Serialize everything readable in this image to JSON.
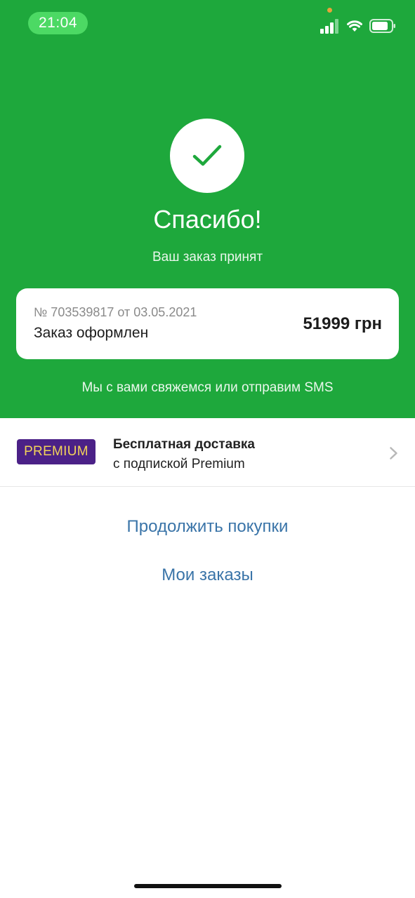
{
  "status_bar": {
    "time": "21:04",
    "icons": [
      "signal-icon",
      "wifi-icon",
      "battery-icon"
    ]
  },
  "confirmation": {
    "icon": "checkmark-icon",
    "title": "Спасибо!",
    "subtitle": "Ваш заказ принят"
  },
  "order": {
    "meta": "№ 703539817 от 03.05.2021",
    "status": "Заказ оформлен",
    "price": "51999 грн"
  },
  "note": "Мы с вами свяжемся или отправим SMS",
  "premium": {
    "badge": "PREMIUM",
    "title": "Бесплатная доставка",
    "subtitle": "с подпиской Premium"
  },
  "actions": {
    "continue_label": "Продолжить покупки",
    "orders_label": "Мои заказы"
  },
  "colors": {
    "brand_green": "#1ea83c",
    "link_blue": "#3a74a8",
    "premium_purple": "#4b2187",
    "premium_gold": "#f2d35a"
  }
}
